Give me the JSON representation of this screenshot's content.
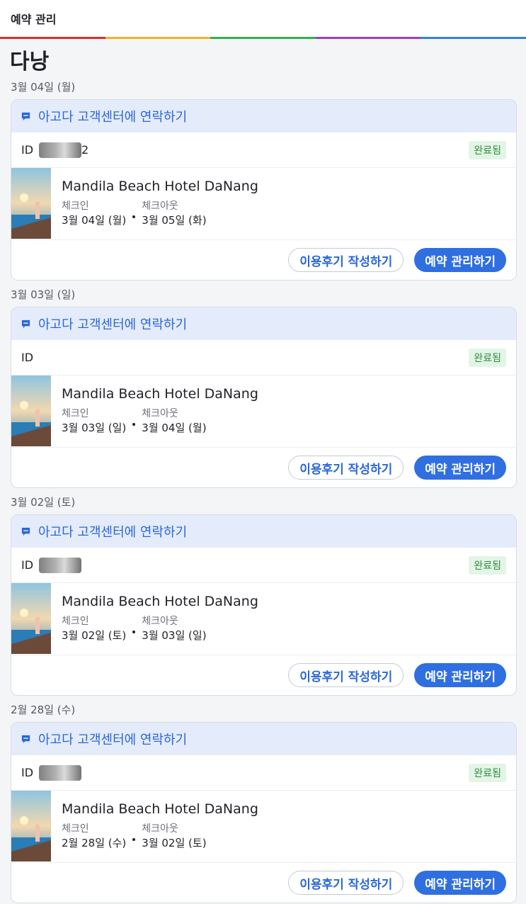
{
  "header": {
    "title": "예약 관리"
  },
  "city": "다낭",
  "bookings": [
    {
      "date": "3월 04일 (월)",
      "contact": "아고다 고객센터에 연락하기",
      "id_label": "ID",
      "id_tail": "2",
      "status": "완료됨",
      "hotel": "Mandila Beach Hotel DaNang",
      "checkin_label": "체크인",
      "checkin": "3월 04일 (월)",
      "checkout_label": "체크아웃",
      "checkout": "3월 05일 (화)",
      "review_button": "이용후기 작성하기",
      "manage_button": "예약 관리하기"
    },
    {
      "date": "3월 03일 (일)",
      "contact": "아고다 고객센터에 연락하기",
      "id_label": "ID",
      "id_tail": "",
      "status": "완료됨",
      "hotel": "Mandila Beach Hotel DaNang",
      "checkin_label": "체크인",
      "checkin": "3월 03일 (일)",
      "checkout_label": "체크아웃",
      "checkout": "3월 04일 (월)",
      "review_button": "이용후기 작성하기",
      "manage_button": "예약 관리하기"
    },
    {
      "date": "3월 02일 (토)",
      "contact": "아고다 고객센터에 연락하기",
      "id_label": "ID",
      "id_tail": "",
      "status": "완료됨",
      "hotel": "Mandila Beach Hotel DaNang",
      "checkin_label": "체크인",
      "checkin": "3월 02일 (토)",
      "checkout_label": "체크아웃",
      "checkout": "3월 03일 (일)",
      "review_button": "이용후기 작성하기",
      "manage_button": "예약 관리하기"
    },
    {
      "date": "2월 28일 (수)",
      "contact": "아고다 고객센터에 연락하기",
      "id_label": "ID",
      "id_tail": "",
      "status": "완료됨",
      "hotel": "Mandila Beach Hotel DaNang",
      "checkin_label": "체크인",
      "checkin": "2월 28일 (수)",
      "checkout_label": "체크아웃",
      "checkout": "3월 02일 (토)",
      "review_button": "이용후기 작성하기",
      "manage_button": "예약 관리하기"
    }
  ],
  "colors": {
    "accent": "#2f6fe0",
    "contact_bg": "#e4ebfb",
    "status_bg": "#e3f5e6",
    "status_text": "#2f8e3e"
  },
  "icons": {
    "contact": "chat-bubble-icon",
    "thumbnail": "hotel-photo"
  }
}
